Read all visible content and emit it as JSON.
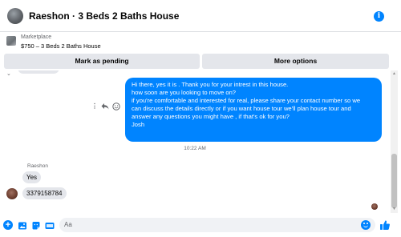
{
  "header": {
    "title": "Raeshon · 3 Beds 2 Baths House",
    "info_icon": "info-icon"
  },
  "marketplace": {
    "label": "Marketplace",
    "item": "$750 – 3 Beds 2 Baths House"
  },
  "actions": {
    "mark_pending": "Mark as pending",
    "more_options": "More options"
  },
  "thread": {
    "sent_message": {
      "lines": [
        "Hi there, yes it is . Thank you for your intrest in this house.",
        "how soon are you looking to move on?",
        "if you're comfortable and interested for real, please share your contact number so we",
        "can discuss the details directly or if you  want house tour we'll plan house tour and",
        "answer any questions you might have , if that's ok for you?",
        "Josh"
      ]
    },
    "timestamp": "10:22 AM",
    "sender_name": "Raeshon",
    "received": [
      "Yes",
      "3379158784"
    ]
  },
  "composer": {
    "placeholder": "Aa"
  },
  "colors": {
    "accent": "#0084ff",
    "bubble_in": "#e4e6eb",
    "button_bg": "#e4e6eb"
  },
  "icons": [
    "info-icon",
    "more-dots-icon",
    "reply-icon",
    "react-icon",
    "plus-icon",
    "photo-icon",
    "sticker-icon",
    "gif-icon",
    "emoji-icon",
    "like-icon"
  ]
}
